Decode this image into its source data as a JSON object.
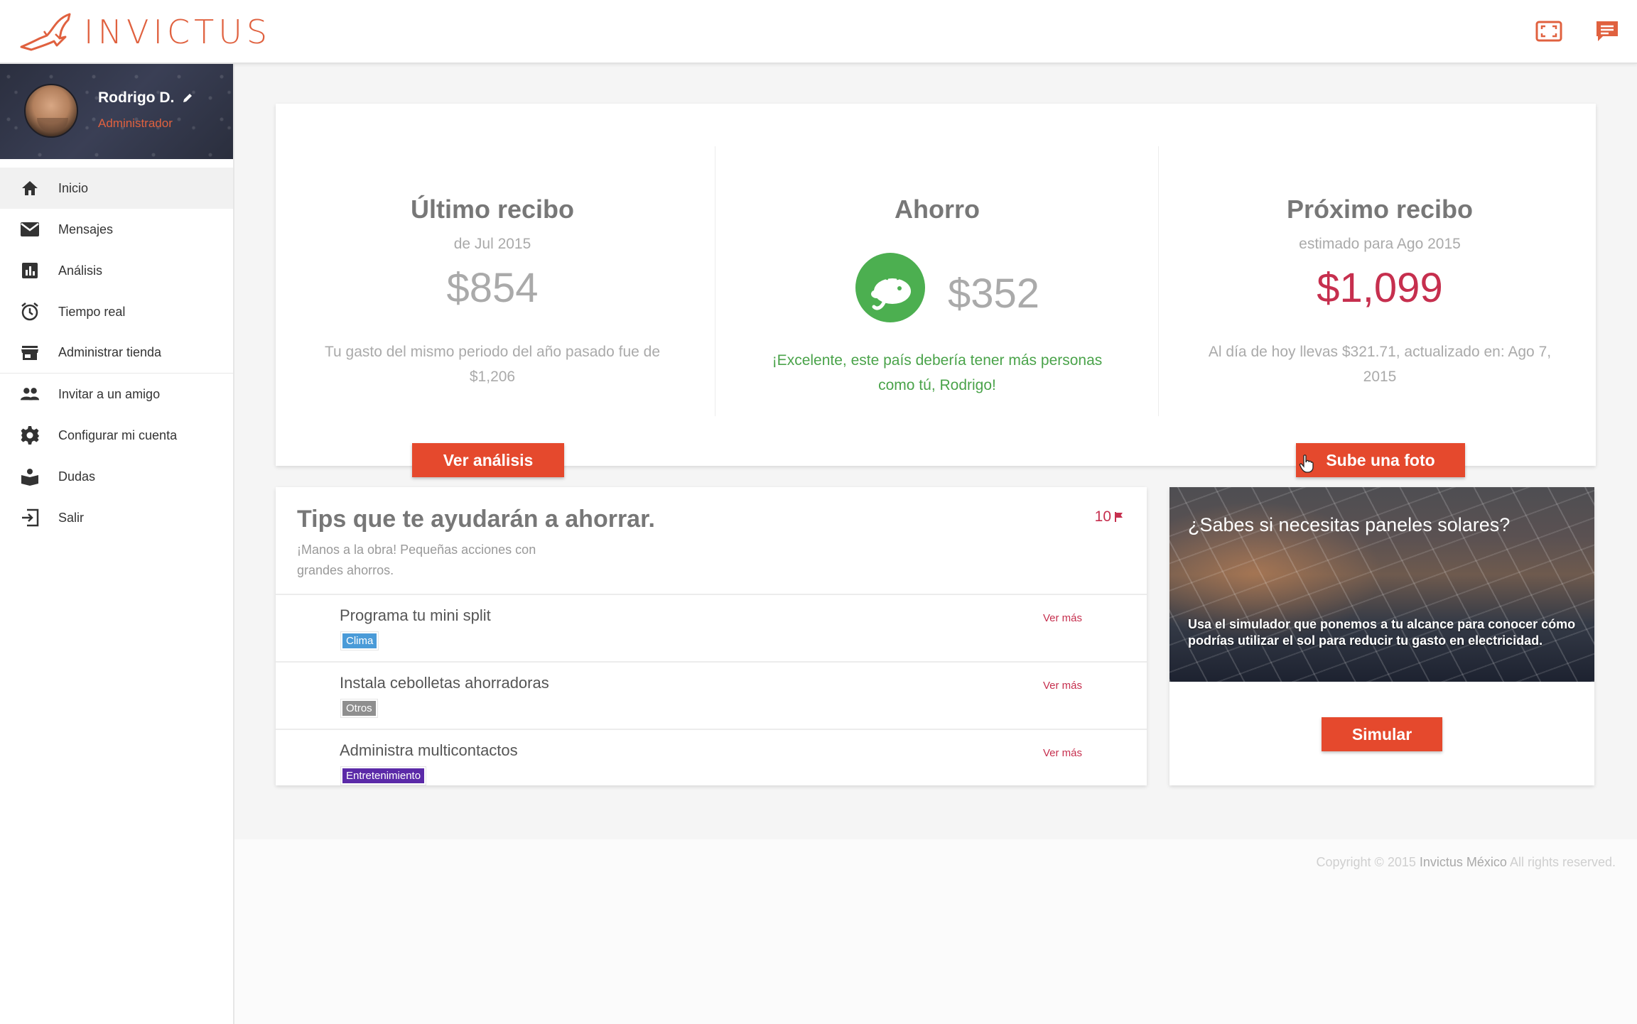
{
  "header": {
    "logo_text": "INVICTUS",
    "brand_color": "#e0613f",
    "icons": [
      "fullscreen-icon",
      "chat-icon"
    ]
  },
  "profile": {
    "name": "Rodrigo D.",
    "role": "Administrador"
  },
  "sidebar": {
    "items": [
      {
        "label": "Inicio",
        "icon": "home-icon"
      },
      {
        "label": "Mensajes",
        "icon": "mail-icon"
      },
      {
        "label": "Análisis",
        "icon": "chart-icon"
      },
      {
        "label": "Tiempo real",
        "icon": "clock-icon"
      },
      {
        "label": "Administrar tienda",
        "icon": "store-icon"
      },
      {
        "label": "Invitar a un amigo",
        "icon": "people-icon"
      },
      {
        "label": "Configurar mi cuenta",
        "icon": "gear-icon"
      },
      {
        "label": "Dudas",
        "icon": "book-icon"
      },
      {
        "label": "Salir",
        "icon": "exit-icon"
      }
    ]
  },
  "summary": {
    "last": {
      "title": "Último recibo",
      "subtitle": "de Jul 2015",
      "amount": "$854",
      "desc": "Tu gasto del mismo periodo del año pasado fue de $1,206",
      "button": "Ver análisis"
    },
    "savings": {
      "title": "Ahorro",
      "amount": "$352",
      "desc": "¡Excelente, este país debería tener más personas como tú, Rodrigo!"
    },
    "next": {
      "title": "Próximo recibo",
      "subtitle": "estimado para Ago 2015",
      "amount": "$1,099",
      "desc": "Al día de hoy llevas $321.71, actualizado en: Ago 7, 2015",
      "button": "Sube una foto"
    }
  },
  "tips": {
    "title": "Tips que te ayudarán a ahorrar.",
    "subtitle": "¡Manos a la obra! Pequeñas acciones con grandes ahorros.",
    "count": "10",
    "items": [
      {
        "title": "Programa tu mini split",
        "tag": "Clima",
        "tag_color": "#4a9bd8",
        "more": "Ver más"
      },
      {
        "title": "Instala cebolletas ahorradoras",
        "tag": "Otros",
        "tag_color": "#8f8f8f",
        "more": "Ver más"
      },
      {
        "title": "Administra multicontactos",
        "tag": "Entretenimiento",
        "tag_color": "#5b2aa8",
        "more": "Ver más"
      }
    ]
  },
  "solar": {
    "title": "¿Sabes si necesitas paneles solares?",
    "desc": "Usa el simulador que ponemos a tu alcance para conocer cómo podrías utilizar el sol para reducir tu gasto en electricidad.",
    "button": "Simular"
  },
  "footer": {
    "copyright_prefix": "Copyright © 2015",
    "company": "Invictus México",
    "suffix": "All rights reserved."
  }
}
